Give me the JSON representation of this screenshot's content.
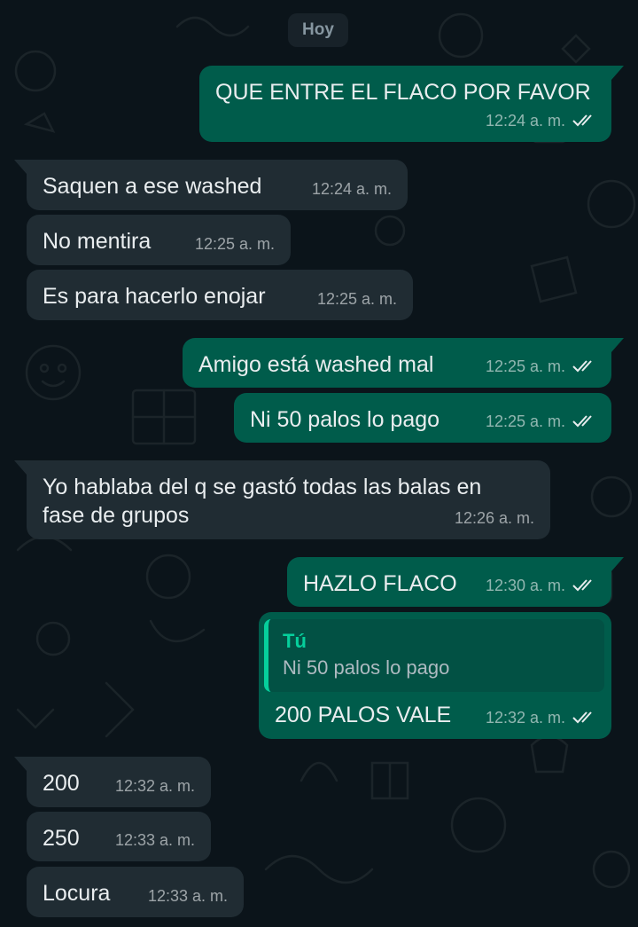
{
  "date_chip": "Hoy",
  "messages": [
    {
      "dir": "out",
      "text": "QUE ENTRE EL FLACO POR FAVOR",
      "time": "12:24 a. m.",
      "status": "read"
    },
    {
      "dir": "in",
      "text": "Saquen a ese washed",
      "time": "12:24 a. m."
    },
    {
      "dir": "in",
      "text": "No mentira",
      "time": "12:25 a. m."
    },
    {
      "dir": "in",
      "text": "Es para hacerlo enojar",
      "time": "12:25 a. m."
    },
    {
      "dir": "out",
      "text": "Amigo está washed mal",
      "time": "12:25 a. m.",
      "status": "read"
    },
    {
      "dir": "out",
      "text": "Ni 50 palos lo pago",
      "time": "12:25 a. m.",
      "status": "read"
    },
    {
      "dir": "in",
      "text": "Yo hablaba del q se gastó todas las balas en fase de grupos",
      "time": "12:26 a. m."
    },
    {
      "dir": "out",
      "text": "HAZLO FLACO",
      "time": "12:30 a. m.",
      "status": "read"
    },
    {
      "dir": "out",
      "quote": {
        "author": "Tú",
        "text": "Ni 50 palos lo pago"
      },
      "text": "200 PALOS VALE",
      "time": "12:32 a. m.",
      "status": "read"
    },
    {
      "dir": "in",
      "text": "200",
      "time": "12:32 a. m."
    },
    {
      "dir": "in",
      "text": "250",
      "time": "12:33 a. m."
    },
    {
      "dir": "in",
      "text": "Locura",
      "time": "12:33 a. m."
    }
  ],
  "colors": {
    "background": "#0b141a",
    "incoming_bubble": "#202c33",
    "outgoing_bubble": "#005c4b",
    "read_ticks": "#e9edef",
    "quote_bar": "#06cf9c"
  },
  "icons": {
    "status_read": "double-check-icon"
  }
}
